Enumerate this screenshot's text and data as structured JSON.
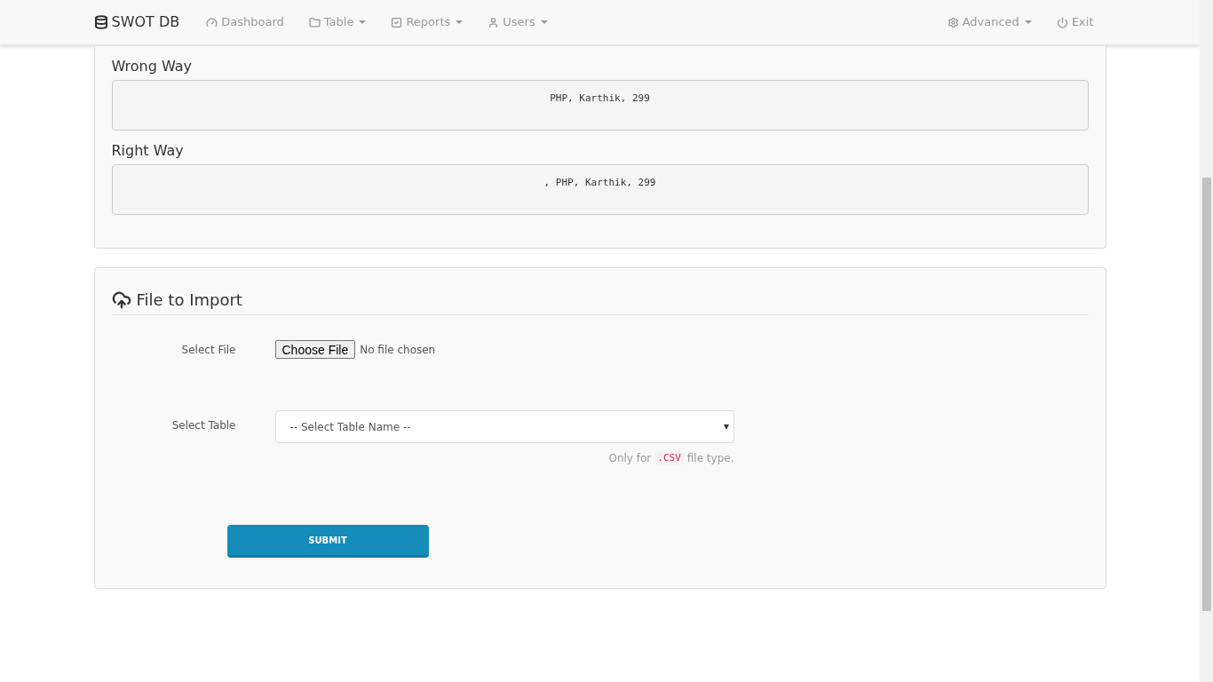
{
  "navbar": {
    "brand": "SWOT DB",
    "left_items": [
      {
        "label": "Dashboard",
        "dropdown": false
      },
      {
        "label": "Table",
        "dropdown": true
      },
      {
        "label": "Reports",
        "dropdown": true
      },
      {
        "label": "Users",
        "dropdown": true
      }
    ],
    "right_items": [
      {
        "label": "Advanced",
        "dropdown": true
      },
      {
        "label": "Exit",
        "dropdown": false
      }
    ]
  },
  "examples": [
    {
      "title": "Wrong Way",
      "code": "PHP, Karthik, 299"
    },
    {
      "title": "Right Way",
      "code": ", PHP, Karthik, 299"
    }
  ],
  "import_panel": {
    "title": "File to Import",
    "file_label": "Select File",
    "file_button": "Choose File",
    "file_status": "No file chosen",
    "table_label": "Select Table",
    "table_placeholder": "-- Select Table Name --",
    "help_before": "Only for",
    "help_code": ".CSV",
    "help_after": "file type.",
    "submit": "SUBMIT"
  }
}
